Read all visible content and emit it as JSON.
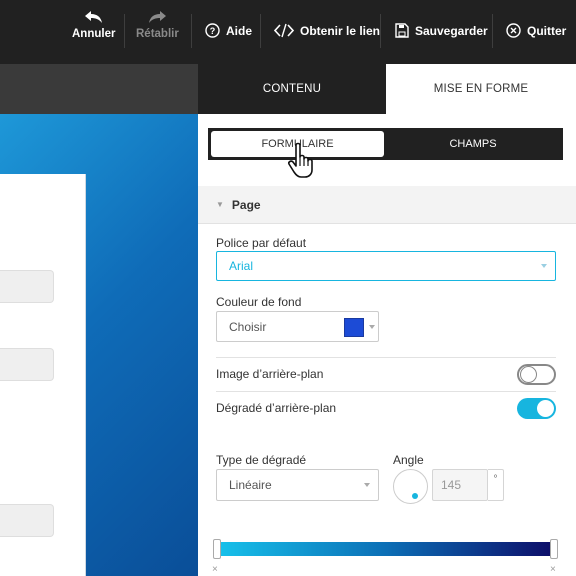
{
  "toolbar": {
    "undo_label": "Annuler",
    "redo_label": "Rétablir",
    "help_label": "Aide",
    "link_label": "Obtenir le lien",
    "save_label": "Sauvegarder",
    "quit_label": "Quitter"
  },
  "panel": {
    "tabs": [
      {
        "label": "CONTENU"
      },
      {
        "label": "MISE EN FORME"
      }
    ],
    "subtabs": [
      {
        "label": "FORMULAIRE"
      },
      {
        "label": "CHAMPS"
      }
    ],
    "section_title": "Page",
    "font": {
      "label": "Police par défaut",
      "value": "Arial"
    },
    "background_color": {
      "label": "Couleur de fond",
      "button_label": "Choisir",
      "swatch_color": "#1c4bd6"
    },
    "background_image": {
      "label": "Image d’arrière-plan",
      "enabled": false
    },
    "background_gradient": {
      "label": "Dégradé d’arrière-plan",
      "enabled": true
    },
    "gradient_type": {
      "label": "Type de dégradé",
      "value": "Linéaire"
    },
    "angle": {
      "label": "Angle",
      "value": "145",
      "unit": "°"
    },
    "gradient_colors": [
      "#17c0ea",
      "#0d0f6a"
    ],
    "gradient_remove_symbol": "×"
  },
  "colors": {
    "accent": "#17b5df",
    "toolbar_bg": "#212121"
  }
}
